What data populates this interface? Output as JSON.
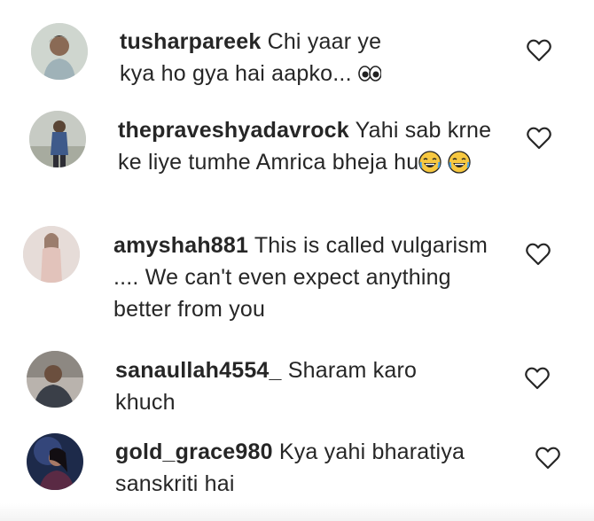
{
  "comments": [
    {
      "username": "tusharpareek",
      "text": "Chi yaar ye kya ho gya hai aapko...",
      "emojis": [
        "eyes-emoji"
      ]
    },
    {
      "username": "thepraveshyadavrock",
      "text": "Yahi sab krne ke liye tumhe Amrica bheja hu",
      "emojis": [
        "joy-emoji",
        "joy-emoji"
      ]
    },
    {
      "username": "amyshah881",
      "text": "This is called vulgarism .... We can't even expect anything better from you",
      "emojis": []
    },
    {
      "username": "sanaullah4554_",
      "text": "Sharam karo khuch",
      "emojis": []
    },
    {
      "username": "gold_grace980",
      "text": "Kya yahi bharatiya sanskriti hai",
      "emojis": []
    }
  ],
  "icons": {
    "like": "heart-outline-icon"
  },
  "colors": {
    "text": "#262626",
    "icon": "#262626"
  }
}
